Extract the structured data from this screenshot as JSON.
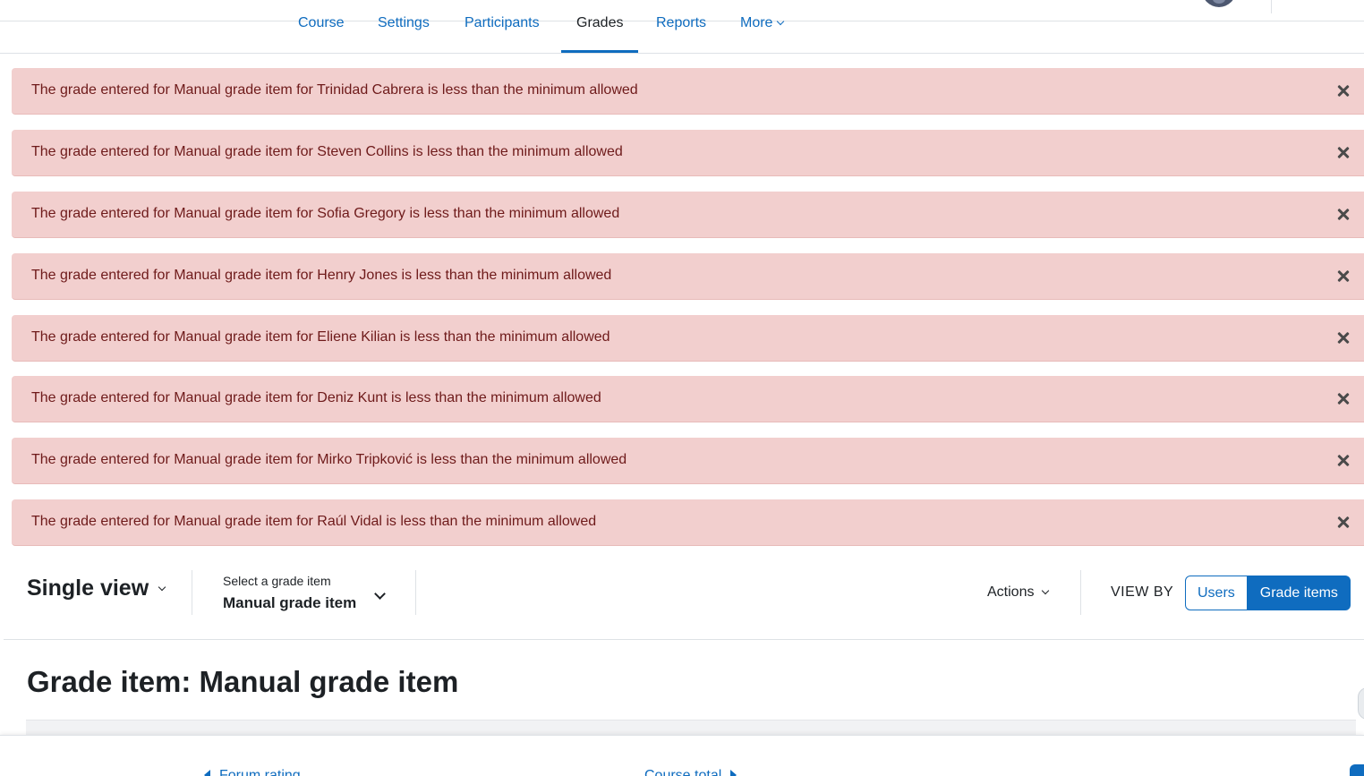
{
  "nav": {
    "tabs": [
      {
        "label": "Course"
      },
      {
        "label": "Settings"
      },
      {
        "label": "Participants"
      },
      {
        "label": "Grades"
      },
      {
        "label": "Reports"
      },
      {
        "label": "More"
      }
    ],
    "active_tab": "Grades"
  },
  "alerts": [
    {
      "message": "The grade entered for Manual grade item for Trinidad Cabrera is less than the minimum allowed"
    },
    {
      "message": "The grade entered for Manual grade item for Steven Collins is less than the minimum allowed"
    },
    {
      "message": "The grade entered for Manual grade item for Sofia Gregory is less than the minimum allowed"
    },
    {
      "message": "The grade entered for Manual grade item for Henry Jones is less than the minimum allowed"
    },
    {
      "message": "The grade entered for Manual grade item for Eliene Kilian is less than the minimum allowed"
    },
    {
      "message": "The grade entered for Manual grade item for Deniz Kunt is less than the minimum allowed"
    },
    {
      "message": "The grade entered for Manual grade item for Mirko Tripković is less than the minimum allowed"
    },
    {
      "message": "The grade entered for Manual grade item for Raúl Vidal is less than the minimum allowed"
    }
  ],
  "toolbar": {
    "report_selector": "Single view",
    "grade_item_label": "Select a grade item",
    "grade_item_value": "Manual grade item",
    "actions_label": "Actions",
    "view_by_label": "VIEW BY",
    "view_by_users": "Users",
    "view_by_grade_items": "Grade items"
  },
  "main": {
    "heading": "Grade item: Manual grade item"
  },
  "footer": {
    "prev_label": "Forum rating",
    "next_label": "Course total"
  },
  "colors": {
    "primary": "#0f6cbf",
    "alert_bg": "#f2cfce",
    "alert_text": "#6e1a1a"
  }
}
